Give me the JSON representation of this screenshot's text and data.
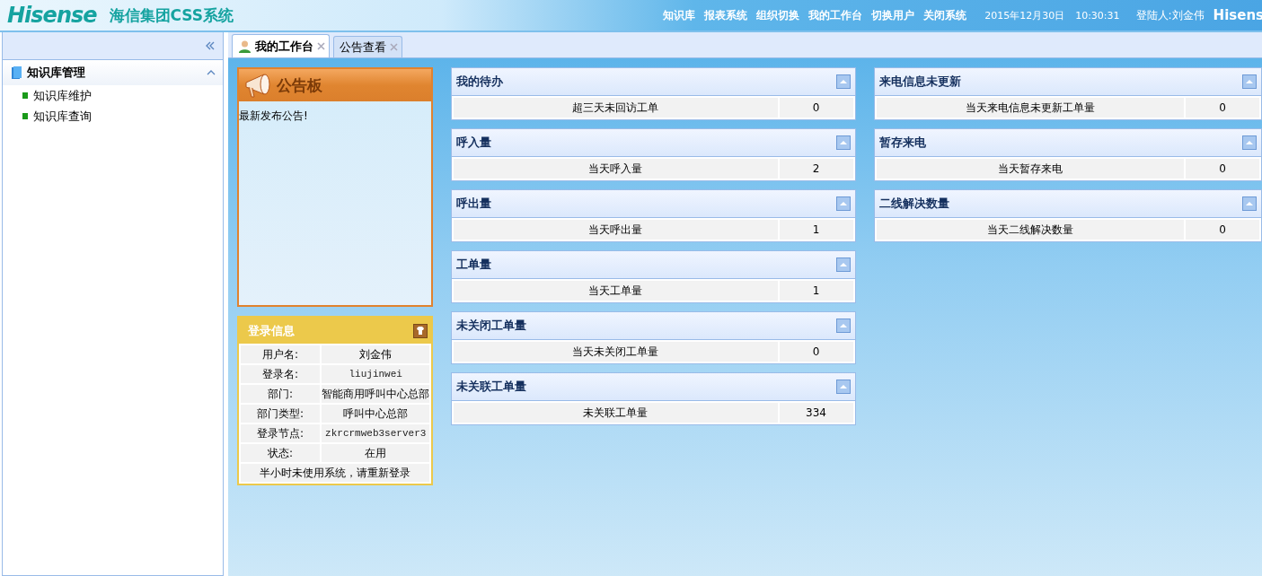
{
  "header": {
    "logo": "Hisense",
    "system_title": "海信集团CSS系统",
    "nav": [
      "知识库",
      "报表系统",
      "组织切换",
      "我的工作台",
      "切换用户",
      "关闭系统"
    ],
    "date": "2015年12月30日",
    "time": "10:30:31",
    "user": "登陆人:刘金伟",
    "brand_cut": "Hisens"
  },
  "sidebar": {
    "group": {
      "title": "知识库管理",
      "expanded": true,
      "children": [
        {
          "label": "知识库维护"
        },
        {
          "label": "知识库查询"
        }
      ]
    }
  },
  "tabs": [
    {
      "label": "我的工作台",
      "selected": true
    },
    {
      "label": "公告查看",
      "selected": false
    }
  ],
  "notice_board": {
    "title": "公告板",
    "message": "最新发布公告!"
  },
  "login_info": {
    "title": "登录信息",
    "rows": [
      {
        "label": "用户名:",
        "value": "刘金伟",
        "mono": false
      },
      {
        "label": "登录名:",
        "value": "liujinwei",
        "mono": true
      },
      {
        "label": "部门:",
        "value": "智能商用呼叫中心总部",
        "mono": false
      },
      {
        "label": "部门类型:",
        "value": "呼叫中心总部",
        "mono": false
      },
      {
        "label": "登录节点:",
        "value": "zkrcrmweb3server3",
        "mono": true
      },
      {
        "label": "状态:",
        "value": "在用",
        "mono": false
      }
    ],
    "footer": "半小时未使用系统，请重新登录"
  },
  "panels_left": [
    {
      "title": "我的待办",
      "rows": [
        {
          "label": "超三天未回访工单",
          "value": "0"
        }
      ]
    },
    {
      "title": "呼入量",
      "rows": [
        {
          "label": "当天呼入量",
          "value": "2"
        }
      ]
    },
    {
      "title": "呼出量",
      "rows": [
        {
          "label": "当天呼出量",
          "value": "1"
        }
      ]
    },
    {
      "title": "工单量",
      "rows": [
        {
          "label": "当天工单量",
          "value": "1"
        }
      ]
    },
    {
      "title": "未关闭工单量",
      "rows": [
        {
          "label": "当天未关闭工单量",
          "value": "0"
        }
      ]
    },
    {
      "title": "未关联工单量",
      "rows": [
        {
          "label": "未关联工单量",
          "value": "334"
        }
      ]
    }
  ],
  "panels_right": [
    {
      "title": "来电信息未更新",
      "rows": [
        {
          "label": "当天来电信息未更新工单量",
          "value": "0"
        }
      ]
    },
    {
      "title": "暂存来电",
      "rows": [
        {
          "label": "当天暂存来电",
          "value": "0"
        }
      ]
    },
    {
      "title": "二线解决数量",
      "rows": [
        {
          "label": "当天二线解决数量",
          "value": "0"
        }
      ]
    }
  ]
}
